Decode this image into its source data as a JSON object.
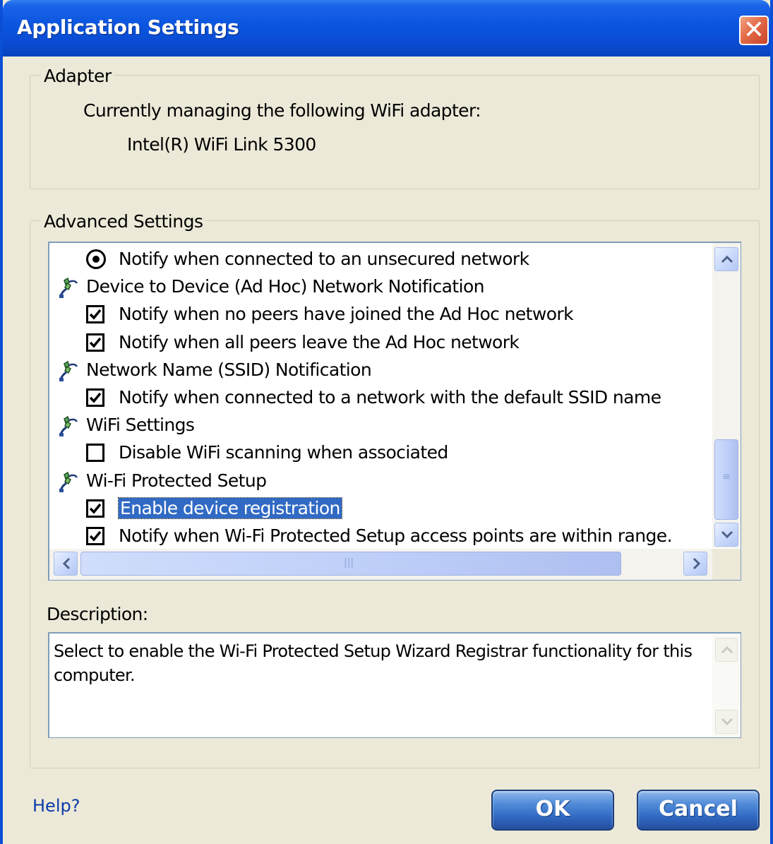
{
  "window": {
    "title": "Application Settings"
  },
  "adapter": {
    "legend": "Adapter",
    "managing_text": "Currently managing the following WiFi adapter:",
    "adapter_name": "Intel(R) WiFi Link 5300"
  },
  "advanced": {
    "legend": "Advanced Settings",
    "items": [
      {
        "kind": "radio",
        "label": "Notify when connected to an unsecured network",
        "checked": true
      },
      {
        "kind": "category",
        "label": "Device to Device (Ad Hoc) Network Notification",
        "icon": "network-plug-icon"
      },
      {
        "kind": "checkbox",
        "label": "Notify when no peers have joined the Ad Hoc network",
        "checked": true
      },
      {
        "kind": "checkbox",
        "label": "Notify when all peers leave the Ad Hoc network",
        "checked": true
      },
      {
        "kind": "category",
        "label": "Network Name (SSID) Notification",
        "icon": "network-plug-icon"
      },
      {
        "kind": "checkbox",
        "label": "Notify when connected to a network with the default SSID name",
        "checked": true
      },
      {
        "kind": "category",
        "label": "WiFi Settings",
        "icon": "network-plug-icon"
      },
      {
        "kind": "checkbox",
        "label": "Disable WiFi scanning when associated",
        "checked": false
      },
      {
        "kind": "category",
        "label": "Wi-Fi Protected Setup",
        "icon": "network-plug-icon"
      },
      {
        "kind": "checkbox",
        "label": "Enable device registration",
        "checked": true,
        "selected": true
      },
      {
        "kind": "checkbox",
        "label": "Notify when Wi-Fi Protected Setup access points are within range.",
        "checked": true
      }
    ]
  },
  "description": {
    "label": "Description:",
    "text": "Select to enable the Wi-Fi Protected Setup Wizard Registrar functionality for this computer."
  },
  "footer": {
    "help_label": "Help?",
    "ok_label": "OK",
    "cancel_label": "Cancel"
  },
  "colors": {
    "titlebar": "#0a55df",
    "selection": "#316ac5",
    "dialog_bg": "#ece9d8",
    "link": "#0b3aa8"
  }
}
